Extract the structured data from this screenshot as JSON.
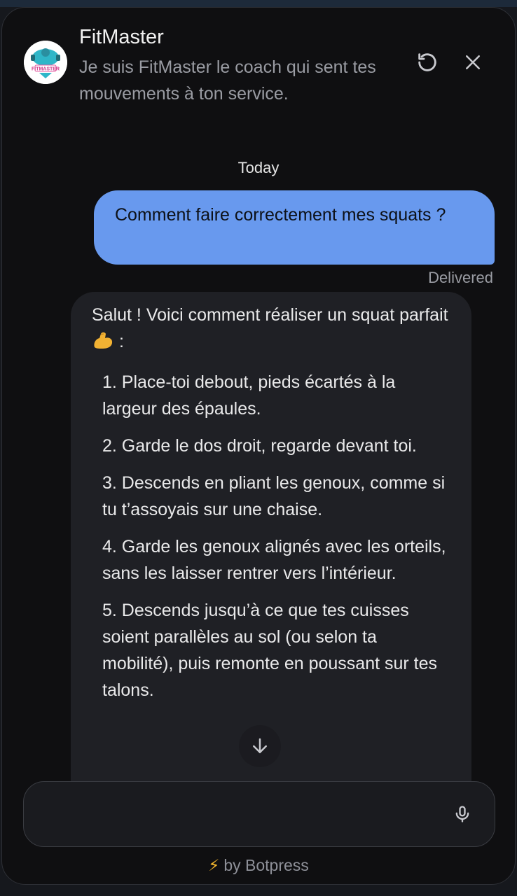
{
  "header": {
    "title": "FitMaster",
    "subtitle": "Je suis FitMaster le coach qui sent tes mouvements à ton service.",
    "avatar_text": "FITMASTER",
    "reset_icon": "refresh-icon",
    "close_icon": "close-icon"
  },
  "chat": {
    "date_separator": "Today",
    "user_message": "Comment faire correctement mes squats ?",
    "user_message_status": "Delivered",
    "bot_message": {
      "intro": "Salut ! Voici comment réaliser un squat parfait",
      "intro_suffix": ":",
      "emoji": "flexed-biceps-emoji",
      "steps": [
        "1. Place-toi debout, pieds écartés à la largeur des épaules.",
        "2. Garde le dos droit, regarde devant toi.",
        "3. Descends en pliant les genoux, comme si tu t’assoyais sur une chaise.",
        "4. Garde les genoux alignés avec les orteils, sans les laisser rentrer vers l’intérieur.",
        "5. Descends jusqu’à ce que tes cuisses soient parallèles au sol (ou selon ta mobilité), puis remonte en poussant sur tes talons."
      ]
    }
  },
  "composer": {
    "placeholder": "",
    "mic_icon": "microphone-icon"
  },
  "footer": {
    "text": "by Botpress",
    "icon": "lightning-icon"
  },
  "colors": {
    "background": "#0f0f11",
    "user_bubble": "#6899ee",
    "bot_bubble": "#1f2025",
    "accent_bolt": "#f5b82e"
  }
}
